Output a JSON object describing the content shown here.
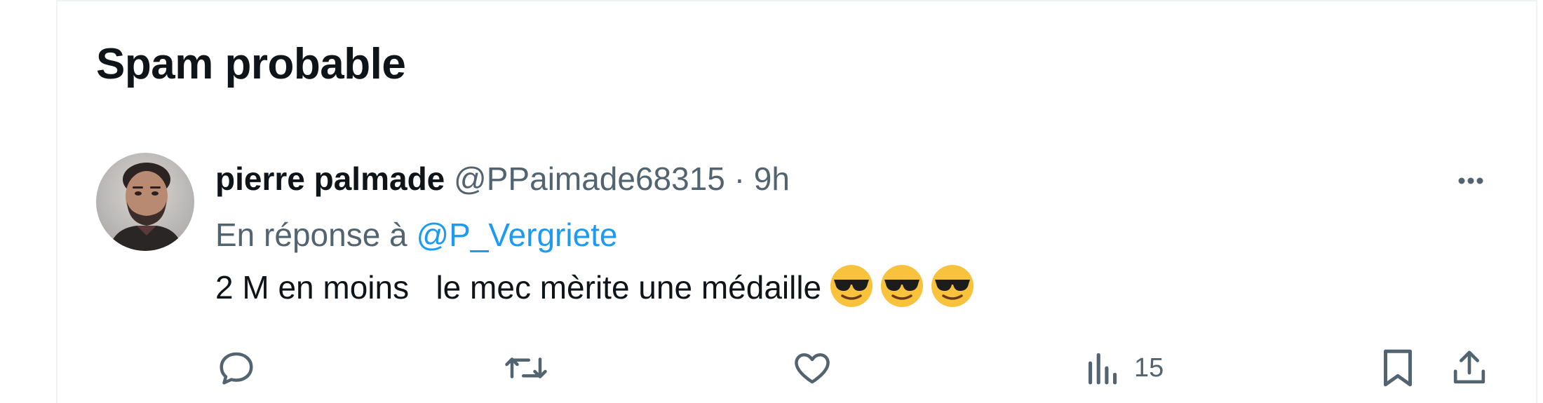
{
  "section": {
    "title": "Spam probable"
  },
  "tweet": {
    "display_name": "pierre palmade",
    "handle": "@PPaimade68315",
    "separator": "·",
    "time": "9h",
    "reply_prefix": "En réponse à",
    "reply_to": "@P_Vergriete",
    "text": "2 M en moins   le mec mèrite une médaille",
    "emoji": [
      "sunglasses-face",
      "sunglasses-face",
      "sunglasses-face"
    ],
    "views_count": "15"
  },
  "icons": {
    "more": "more-horizontal-icon",
    "reply": "reply-bubble-icon",
    "retweet": "retweet-icon",
    "like": "heart-icon",
    "views": "analytics-bars-icon",
    "bookmark": "bookmark-icon",
    "share": "share-upload-icon"
  },
  "colors": {
    "text": "#0f1419",
    "secondary": "#536471",
    "link": "#1d9bf0",
    "emoji": "#f9c23c"
  }
}
